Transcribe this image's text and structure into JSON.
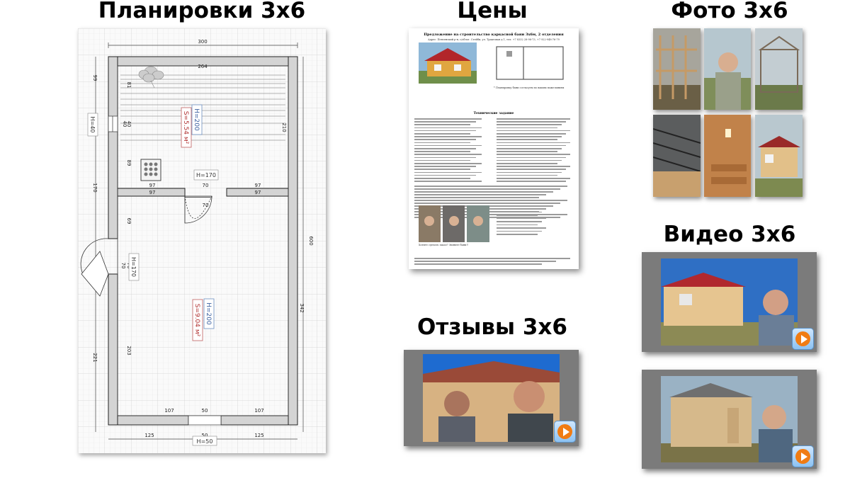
{
  "headings": {
    "plans": "Планировки 3х6",
    "prices": "Цены",
    "photos": "Фото 3х6",
    "video": "Видео 3х6",
    "reviews": "Отзывы 3х6"
  },
  "floor_plan": {
    "dim_top_outer": "300",
    "dim_top_inner": "264",
    "dim_left_top": "99",
    "dim_left_mid": "170",
    "dim_left_bottom": "221",
    "dim_right_outer": "600",
    "dim_right_upper": "210",
    "dim_right_lower": "342",
    "room1_height": "H=200",
    "room1_area": "S=5.54 м²",
    "room2_height": "H=200",
    "room2_area": "S=9.04 м²",
    "window_label": "H=40",
    "door_label": "H=170",
    "side_door_label": "H=170",
    "front_door_label": "H=50",
    "dims": {
      "d97a": "97",
      "d70a": "70",
      "d97b": "97",
      "d97c": "97",
      "d70b": "70",
      "d97d": "97",
      "d81": "81",
      "d40a": "40",
      "d40b": "40",
      "d89": "89",
      "d69": "69",
      "d70c": "70",
      "d70d": "70",
      "d203": "203",
      "d107a": "107",
      "d50a": "50",
      "d107b": "107",
      "d125a": "125",
      "d50b": "50",
      "d125b": "125"
    }
  },
  "price_sheet": {
    "title": "Предложение на строительство каркасной бани 3х6м, 2 отделения",
    "subtitle": "Адрес: Пензенский р-н, с/облог. Стейби, ул. Трактовая д 1, тел: +7 8332 28-98-73, +7 922-948-76-79",
    "section": "Технические задание",
    "caption": "* Планировку бани согласуем по вашим пожеланиям",
    "photo_caption": "Хотите сделать заказ? Звоните бани!!"
  },
  "colors": {
    "wall_fill": "#d4d4d4",
    "grid_line": "#e8e8e8",
    "film_gray": "#7b7b7b",
    "play_orange": "#f07c14"
  }
}
